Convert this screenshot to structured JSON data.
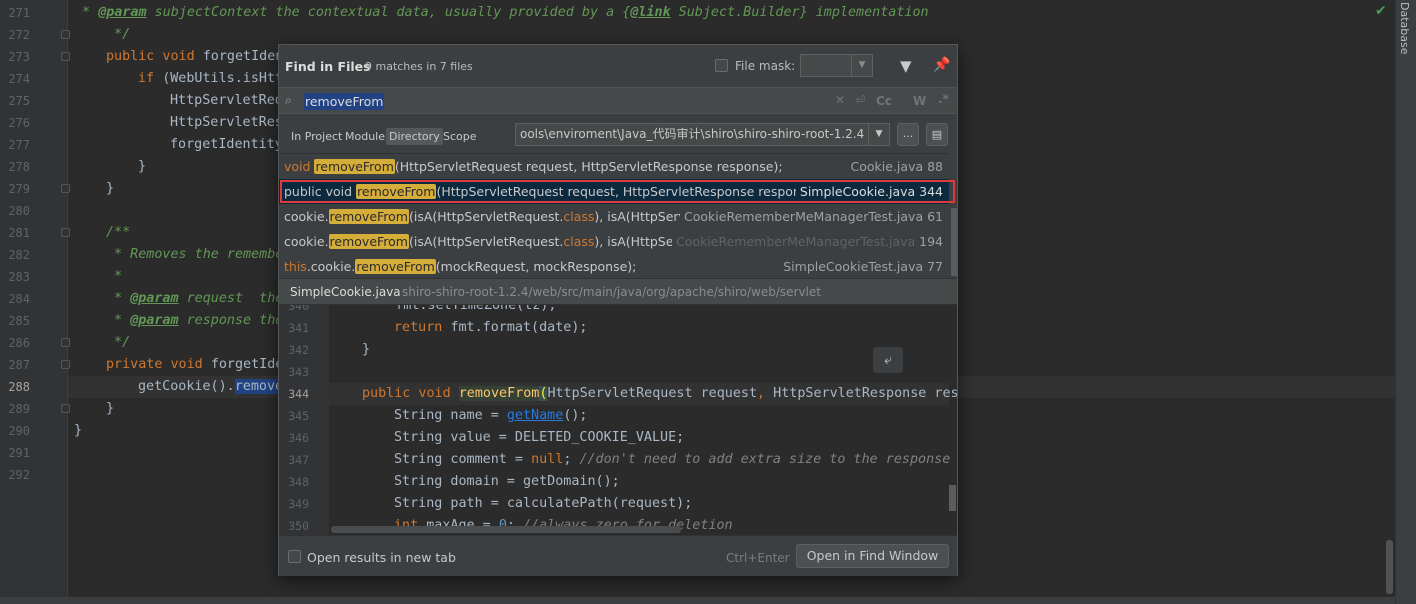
{
  "editor": {
    "line_numbers": [
      "271",
      "272",
      "273",
      "274",
      "275",
      "276",
      "277",
      "278",
      "279",
      "280",
      "281",
      "282",
      "283",
      "284",
      "285",
      "286",
      "287",
      "288",
      "289",
      "290",
      "291",
      "292"
    ],
    "lines": {
      "l271_a": " * ",
      "l271_tag": "@param",
      "l271_b": " subjectContext the contextual data, usually provided by a {",
      "l271_link": "@link",
      "l271_c": " Subject.Builder} implementation",
      "l272": " */",
      "l273_kw": "public void ",
      "l273_b": "forgetIden",
      "l274_kw": "if ",
      "l274_b": "(WebUtils.isHtt",
      "l275": "HttpServletReq",
      "l276": "HttpServletRes",
      "l277": "forgetIdentity",
      "l278": "}",
      "l279": "}",
      "l281": "/**",
      "l282": " * Removes the remembe",
      "l283": " *",
      "l284_a": " * ",
      "l284_tag": "@param",
      "l284_b": " request  the",
      "l285_a": " * ",
      "l285_tag": "@param",
      "l285_b": " response the",
      "l286": " */",
      "l287_kw": "private void ",
      "l287_b": "forgetIde",
      "l288_a": "getCookie().",
      "l288_sel": "remove",
      "l289": "}",
      "l290": "}"
    }
  },
  "right_strip": {
    "label": "Database",
    "check_icon": "✔"
  },
  "find": {
    "title": "Find in Files",
    "match_count": "9 matches in 7 files",
    "file_mask_label": "File mask:",
    "query": "removeFrom",
    "options": {
      "regex_clear": "✕",
      "newline": "⏎",
      "case": "Cc",
      "words": "W",
      "regex": ".*"
    },
    "scopes": {
      "in_project": "In Project",
      "module": "Module",
      "directory": "Directory",
      "scope": "Scope"
    },
    "directory_path": "ools\\enviroment\\Java_代码审计\\shiro\\shiro-shiro-root-1.2.4",
    "browse_label": "...",
    "results": [
      {
        "pre_kw": "void ",
        "pre": "",
        "match": "removeFrom",
        "post": "(HttpServletRequest request, HttpServletResponse response);",
        "file": "Cookie.java 88"
      },
      {
        "pre_kw": "",
        "pre": "public void ",
        "match": "removeFrom",
        "post": "(HttpServletRequest request, HttpServletResponse response) {",
        "file": "SimpleCookie.java 344"
      },
      {
        "pre_kw": "",
        "pre": "cookie.",
        "match": "removeFrom",
        "post": "(isA(HttpServletRequest.",
        "post_kw": "class",
        "post2": "), isA(HttpServletRespo",
        "file": "CookieRememberMeManagerTest.java 61"
      },
      {
        "pre_kw": "",
        "pre": "cookie.",
        "match": "removeFrom",
        "post": "(isA(HttpServletRequest.",
        "post_kw": "class",
        "post2": "), isA(HttpServletResp",
        "file_a": "CookieRememberMeManagerTest.java",
        "file_b": " 194"
      },
      {
        "pre_kw": "this",
        "pre": ".cookie.",
        "match": "removeFrom",
        "post": "(mockRequest, mockResponse);",
        "file": "SimpleCookieTest.java 77"
      }
    ],
    "preview_file": "SimpleCookie.java",
    "preview_path": "shiro-shiro-root-1.2.4/web/src/main/java/org/apache/shiro/web/servlet",
    "preview_line_numbers": [
      "340",
      "341",
      "342",
      "343",
      "344",
      "345",
      "346",
      "347",
      "348",
      "349",
      "350"
    ],
    "preview_lines": {
      "p340": "    fmt.setTimeZone(tz);",
      "p341_kw": "return ",
      "p341_b": "fmt.format(date);",
      "p342": "}",
      "p344_kw": "public void ",
      "p344_fn": "removeFrom",
      "p344_paren": "(",
      "p344_b": "HttpServletRequest request",
      "p344_c": ", ",
      "p344_d": "HttpServletResponse resp",
      "p345_a": "String name = ",
      "p345_link": "getName",
      "p345_b": "();",
      "p346": "String value = DELETED_COOKIE_VALUE;",
      "p347_a": "String comment = ",
      "p347_kw": "null",
      "p347_b": "; ",
      "p347_cmt": "//don't need to add extra size to the response -",
      "p348": "String domain = getDomain();",
      "p349": "String path = calculatePath(request);",
      "p350_kw": "int ",
      "p350_b": "maxAge = ",
      "p350_num": "0",
      "p350_c": "; ",
      "p350_cmt": "//always zero for deletion"
    },
    "open_new_tab_label": "Open results in new tab",
    "shortcut": "Ctrl+Enter",
    "open_button": "Open in Find Window"
  }
}
